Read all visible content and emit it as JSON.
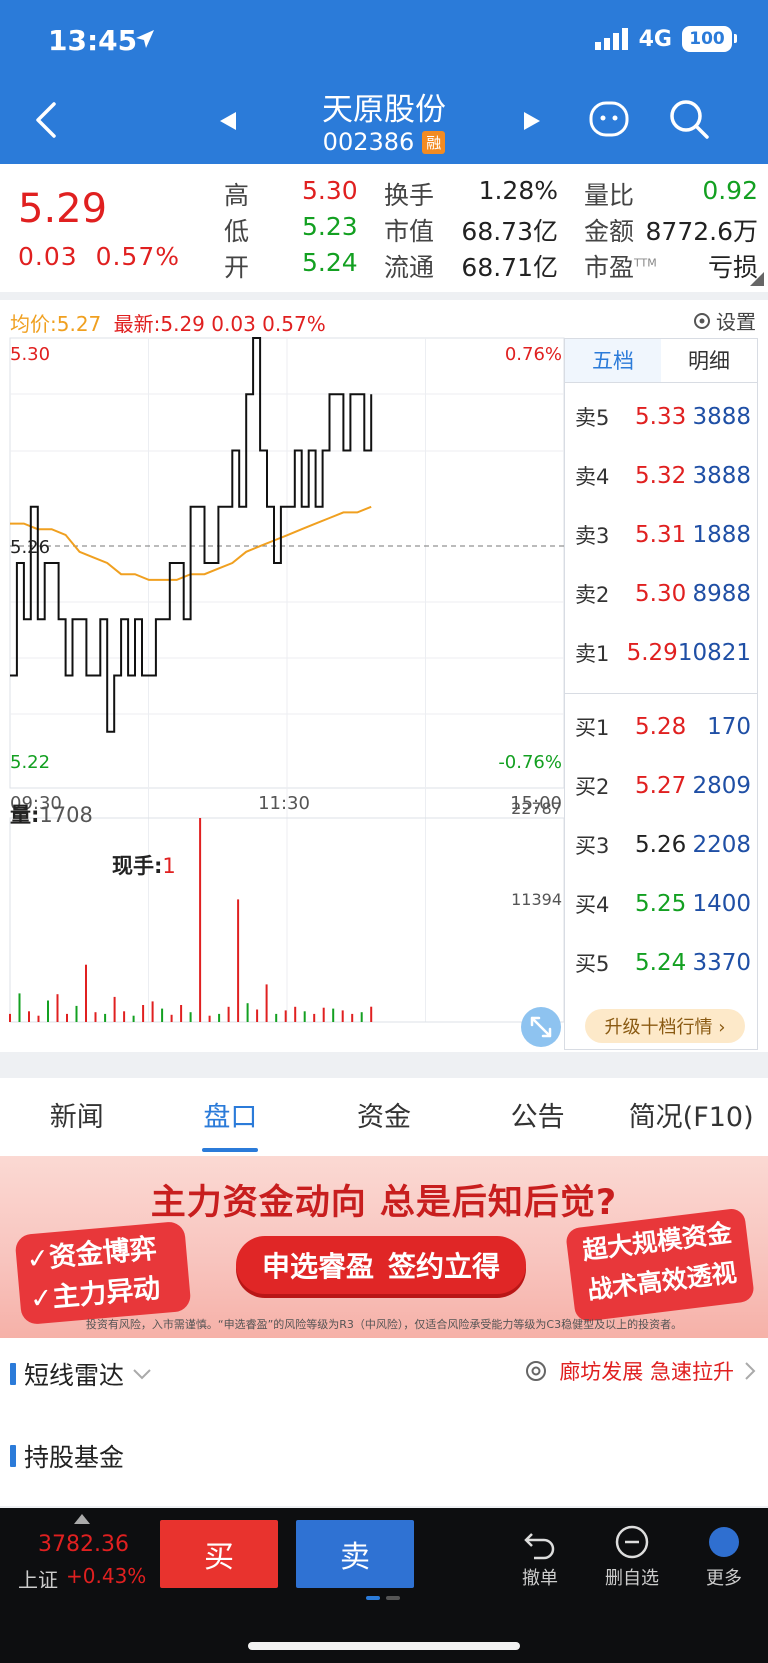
{
  "status": {
    "time": "13:45",
    "network": "4G",
    "battery": "100"
  },
  "header": {
    "stock_name": "天原股份",
    "stock_code": "002386",
    "margin_badge": "融"
  },
  "quote": {
    "price": "5.29",
    "change": "0.03",
    "change_pct": "0.57%",
    "high_label": "高",
    "high": "5.30",
    "low_label": "低",
    "low": "5.23",
    "open_label": "开",
    "open": "5.24",
    "turnover_label": "换手",
    "turnover": "1.28%",
    "mcap_label": "市值",
    "mcap": "68.73亿",
    "float_label": "流通",
    "float": "68.71亿",
    "vol_ratio_label": "量比",
    "vol_ratio": "0.92",
    "amount_label": "金额",
    "amount": "8772.6万",
    "pe_label": "市盈",
    "pe_sup": "TTM",
    "pe": "亏损"
  },
  "chart": {
    "avg_label": "均价:5.27",
    "latest_label": "最新:5.29",
    "latest_change": "0.03",
    "latest_pct": "0.57%",
    "settings": "设置",
    "y_high": "5.30",
    "y_mid": "5.26",
    "y_low": "5.22",
    "pct_high": "0.76%",
    "pct_low": "-0.76%",
    "x_labels": [
      "09:30",
      "11:30",
      "15:00"
    ],
    "volume_label": "量:",
    "volume": "1708",
    "hand_label": "现手:",
    "hand": "1",
    "vol_max": "22787",
    "vol_mid": "11394"
  },
  "chart_data": {
    "type": "line",
    "title": "",
    "xlabel": "",
    "ylabel": "",
    "ylim": [
      5.22,
      5.3
    ],
    "x_ticks": [
      "09:30",
      "11:30",
      "15:00"
    ],
    "series": [
      {
        "values": [
          5.24,
          5.26,
          5.25,
          5.27,
          5.25,
          5.26,
          5.26,
          5.25,
          5.24,
          5.25,
          5.25,
          5.24,
          5.24,
          5.25,
          5.23,
          5.24,
          5.25,
          5.24,
          5.25,
          5.24,
          5.24,
          5.25,
          5.25,
          5.26,
          5.26,
          5.25,
          5.27,
          5.27,
          5.26,
          5.26,
          5.27,
          5.27,
          5.28,
          5.27,
          5.29,
          5.3,
          5.28,
          5.27,
          5.26,
          5.27,
          5.27,
          5.28,
          5.27,
          5.28,
          5.27,
          5.28,
          5.29,
          5.29,
          5.28,
          5.29,
          5.29,
          5.28,
          5.29
        ]
      },
      {
        "values": [
          5.267,
          5.267,
          5.266,
          5.266,
          5.265,
          5.262,
          5.261,
          5.26,
          5.258,
          5.258,
          5.257,
          5.257,
          5.257,
          5.258,
          5.258,
          5.259,
          5.26,
          5.262,
          5.263,
          5.264,
          5.265,
          5.266,
          5.267,
          5.268,
          5.269,
          5.269,
          5.27
        ]
      }
    ],
    "volume": [
      900,
      3200,
      1200,
      700,
      2400,
      3100,
      900,
      1800,
      6400,
      1100,
      900,
      2800,
      1200,
      700,
      1900,
      2300,
      1500,
      800,
      1900,
      1100,
      22787,
      700,
      900,
      1700,
      13700,
      2100,
      1400,
      4200,
      900,
      1300,
      1700,
      1200,
      900,
      1600,
      1500,
      1300,
      900,
      1100,
      1708
    ]
  },
  "order_book": {
    "tabs": [
      "五档",
      "明细"
    ],
    "asks": [
      {
        "label": "卖5",
        "price": "5.33",
        "vol": "3888"
      },
      {
        "label": "卖4",
        "price": "5.32",
        "vol": "3888"
      },
      {
        "label": "卖3",
        "price": "5.31",
        "vol": "1888"
      },
      {
        "label": "卖2",
        "price": "5.30",
        "vol": "8988"
      },
      {
        "label": "卖1",
        "price": "5.29",
        "vol": "10821"
      }
    ],
    "bids": [
      {
        "label": "买1",
        "price": "5.28",
        "vol": "170"
      },
      {
        "label": "买2",
        "price": "5.27",
        "vol": "2809"
      },
      {
        "label": "买3",
        "price": "5.26",
        "vol": "2208"
      },
      {
        "label": "买4",
        "price": "5.25",
        "vol": "1400"
      },
      {
        "label": "买5",
        "price": "5.24",
        "vol": "3370"
      }
    ],
    "upgrade": "升级十档行情 ›"
  },
  "tabs": [
    "新闻",
    "盘口",
    "资金",
    "公告",
    "简况(F10)"
  ],
  "banner": {
    "headline": "主力资金动向 总是后知后觉?",
    "left_1": "✓资金博弈",
    "left_2": "✓主力异动",
    "cta_1": "申选睿盈",
    "cta_2": "签约立得",
    "right_1": "超大规模资金",
    "right_2": "战术高效透视",
    "note": "投资有风险，入市需谨慎。“申选睿盈”的风险等级为R3（中风险），仅适合风险承受能力等级为C3稳健型及以上的投资者。"
  },
  "sections": {
    "radar": "短线雷达",
    "radar_news": "廊坊发展 急速拉升",
    "funds": "持股基金"
  },
  "bottom": {
    "index_value": "3782.36",
    "index_name": "上证",
    "index_pct": "+0.43%",
    "buy": "买",
    "sell": "卖",
    "undo": "撤单",
    "remove_fav": "删自选",
    "more": "更多"
  },
  "colors": {
    "brand": "#2b7bd9",
    "up": "#e02020",
    "down": "#13a021",
    "avg_line": "#f0a020"
  }
}
